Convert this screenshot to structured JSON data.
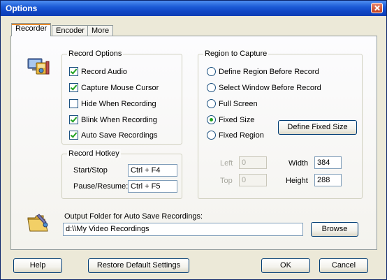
{
  "window": {
    "title": "Options"
  },
  "tabs": [
    {
      "label": "Recorder"
    },
    {
      "label": "Encoder"
    },
    {
      "label": "More"
    }
  ],
  "record_options": {
    "heading": "Record Options",
    "items": [
      {
        "label": "Record Audio",
        "checked": true
      },
      {
        "label": "Capture Mouse Cursor",
        "checked": true
      },
      {
        "label": "Hide When Recording",
        "checked": false
      },
      {
        "label": "Blink When Recording",
        "checked": true
      },
      {
        "label": "Auto Save Recordings",
        "checked": true
      }
    ]
  },
  "record_hotkey": {
    "heading": "Record Hotkey",
    "start_stop_label": "Start/Stop",
    "start_stop_value": "Ctrl + F4",
    "pause_resume_label": "Pause/Resume:",
    "pause_resume_value": "Ctrl + F5"
  },
  "region": {
    "heading": "Region to Capture",
    "options": [
      {
        "label": "Define Region Before Record",
        "selected": false
      },
      {
        "label": "Select Window Before Record",
        "selected": false
      },
      {
        "label": "Full Screen",
        "selected": false
      },
      {
        "label": "Fixed Size",
        "selected": true
      },
      {
        "label": "Fixed Region",
        "selected": false
      }
    ],
    "define_button": "Define Fixed Size",
    "left_label": "Left",
    "left_value": "0",
    "top_label": "Top",
    "top_value": "0",
    "width_label": "Width",
    "width_value": "384",
    "height_label": "Height",
    "height_value": "288"
  },
  "output": {
    "label": "Output Folder for Auto Save Recordings:",
    "value": "d:\\\\My Video Recordings",
    "browse_button": "Browse"
  },
  "footer": {
    "help": "Help",
    "restore": "Restore Default Settings",
    "ok": "OK",
    "cancel": "Cancel"
  },
  "icons": {
    "recorder": "recorder-icon",
    "folder": "folder-icon"
  },
  "colors": {
    "title_bar": "#1046c4",
    "check": "#21a121"
  }
}
